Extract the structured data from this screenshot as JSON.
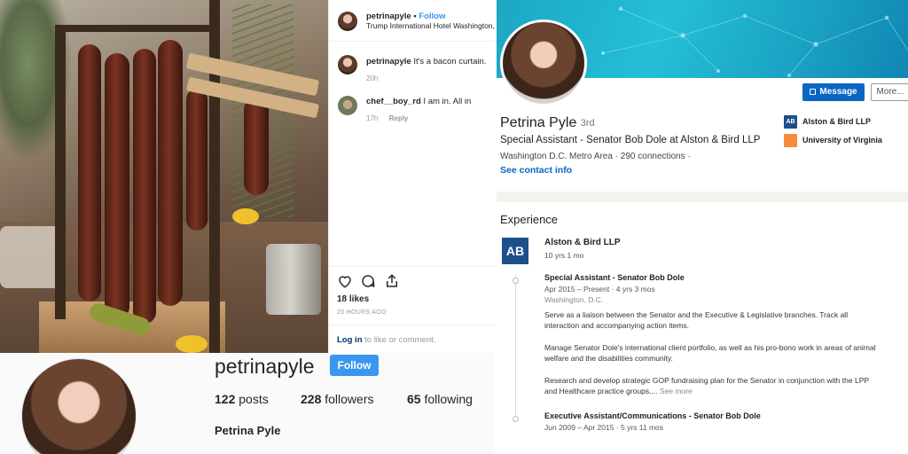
{
  "instagram_post": {
    "author": "petrinapyle",
    "follow_label": "Follow",
    "location": "Trump International Hotel Washington,",
    "comments": [
      {
        "user": "petrinapyle",
        "text": "It's a bacon curtain.",
        "age": "20h",
        "reply": ""
      },
      {
        "user": "chef__boy_rd",
        "text": "I am in. All in",
        "age": "17h",
        "reply": "Reply"
      }
    ],
    "likes": "18 likes",
    "posted": "20 HOURS AGO",
    "login_link": "Log in",
    "login_rest": " to like or comment.",
    "icons": [
      "heart-icon",
      "comment-icon",
      "share-icon"
    ]
  },
  "instagram_profile": {
    "username": "petrinapyle",
    "follow_label": "Follow",
    "posts_count": "122",
    "posts_label": " posts",
    "followers_count": "228",
    "followers_label": " followers",
    "following_count": "65",
    "following_label": " following",
    "full_name": "Petrina Pyle"
  },
  "linkedin": {
    "message_label": "Message",
    "more_label": "More...",
    "name": "Petrina Pyle",
    "degree": "· 3rd",
    "headline": "Special Assistant - Senator Bob Dole at Alston & Bird LLP",
    "location_line": "Washington D.C. Metro Area  ·  290 connections  ·",
    "contact_link": "See contact info",
    "orgs": [
      {
        "logo_text": "AB",
        "name": "Alston & Bird LLP",
        "color": "#1d4f8b"
      },
      {
        "logo_text": "",
        "name": "University of Virginia",
        "color": "#f58a3a"
      }
    ],
    "experience": {
      "section_title": "Experience",
      "company_logo": "AB",
      "company": "Alston & Bird LLP",
      "company_duration": "10 yrs 1 mo",
      "roles": [
        {
          "title": "Special Assistant - Senator Bob Dole",
          "dates": "Apr 2015 – Present  ·  4 yrs 3 mos",
          "location": "Washington, D.C.",
          "paragraphs": [
            "Serve as a liaison between the Senator and the Executive & Legislative branches. Track all interaction and accompanying action items.",
            "Manage Senator Dole's international client portfolio, as well as his pro-bono work in areas of animal welfare and the disabilities community.",
            "Research and develop strategic GOP fundraising plan for the Senator in conjunction with the LPP and Healthcare practice groups.... "
          ],
          "see_more": "See more"
        },
        {
          "title": "Executive Assistant/Communications - Senator Bob Dole",
          "dates": "Jun 2009 – Apr 2015 · 5 yrs 11 mos"
        }
      ]
    }
  }
}
